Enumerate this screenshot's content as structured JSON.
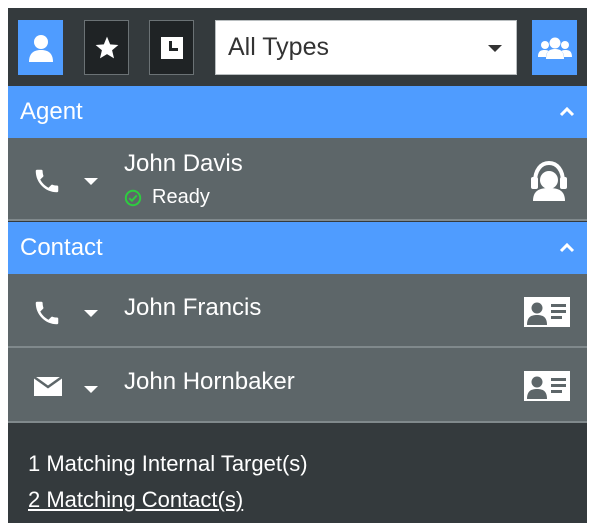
{
  "toolbar": {
    "buttons": [
      {
        "icon": "person-icon",
        "active": true
      },
      {
        "icon": "star-icon",
        "active": false
      },
      {
        "icon": "history-icon",
        "active": false
      }
    ],
    "type_filter": {
      "selected": "All Types"
    },
    "group_button": {
      "icon": "group-icon"
    }
  },
  "sections": {
    "agent": {
      "title": "Agent",
      "items": [
        {
          "channel_icon": "phone-icon",
          "name": "John Davis",
          "status": "Ready",
          "status_color": "#2ecc40",
          "right_icon": "headset-agent-icon"
        }
      ]
    },
    "contact": {
      "title": "Contact",
      "items": [
        {
          "channel_icon": "phone-icon",
          "name": "John Francis",
          "right_icon": "contact-card-icon"
        },
        {
          "channel_icon": "email-icon",
          "name": "John Hornbaker",
          "right_icon": "contact-card-icon"
        }
      ]
    }
  },
  "footer": {
    "internal_targets": "1 Matching Internal Target(s)",
    "contacts_link": "2 Matching Contact(s)"
  },
  "colors": {
    "accent": "#4f9cff",
    "panel_bg": "#343a3d",
    "row_bg": "#5d6669",
    "ready_green": "#2ecc40"
  }
}
